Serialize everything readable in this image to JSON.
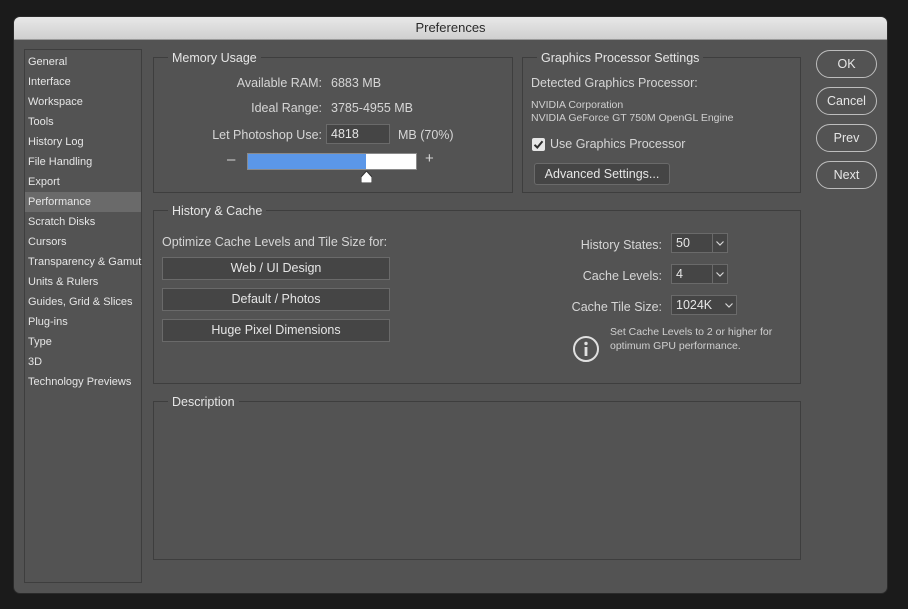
{
  "window": {
    "title": "Preferences"
  },
  "sidebar": {
    "items": [
      {
        "label": "General"
      },
      {
        "label": "Interface"
      },
      {
        "label": "Workspace"
      },
      {
        "label": "Tools"
      },
      {
        "label": "History Log"
      },
      {
        "label": "File Handling"
      },
      {
        "label": "Export"
      },
      {
        "label": "Performance",
        "active": true
      },
      {
        "label": "Scratch Disks"
      },
      {
        "label": "Cursors"
      },
      {
        "label": "Transparency & Gamut"
      },
      {
        "label": "Units & Rulers"
      },
      {
        "label": "Guides, Grid & Slices"
      },
      {
        "label": "Plug-ins"
      },
      {
        "label": "Type"
      },
      {
        "label": "3D"
      },
      {
        "label": "Technology Previews"
      }
    ]
  },
  "memory": {
    "legend": "Memory Usage",
    "available_label": "Available RAM:",
    "available_value": "6883 MB",
    "ideal_label": "Ideal Range:",
    "ideal_value": "3785-4955 MB",
    "let_label": "Let Photoshop Use:",
    "let_value": "4818",
    "unit_label": "MB (70%)",
    "minus": "–",
    "plus": "+",
    "slider_fraction": 0.7
  },
  "gpu": {
    "legend": "Graphics Processor Settings",
    "detected_label": "Detected Graphics Processor:",
    "vendor": "NVIDIA Corporation",
    "model": "NVIDIA GeForce GT 750M OpenGL Engine",
    "use_label": "Use Graphics Processor",
    "use_checked": true,
    "advanced_label": "Advanced Settings..."
  },
  "history": {
    "legend": "History & Cache",
    "optimize_label": "Optimize Cache Levels and Tile Size for:",
    "btn_web": "Web / UI Design",
    "btn_default": "Default / Photos",
    "btn_huge": "Huge Pixel Dimensions",
    "states_label": "History States:",
    "states_value": "50",
    "levels_label": "Cache Levels:",
    "levels_value": "4",
    "tile_label": "Cache Tile Size:",
    "tile_value": "1024K",
    "info_line1": "Set Cache Levels to 2 or higher for",
    "info_line2": "optimum GPU performance."
  },
  "description": {
    "legend": "Description"
  },
  "buttons": {
    "ok": "OK",
    "cancel": "Cancel",
    "prev": "Prev",
    "next": "Next"
  },
  "colors": {
    "slider_fill": "#5b97e8",
    "panel_bg": "#535353"
  }
}
